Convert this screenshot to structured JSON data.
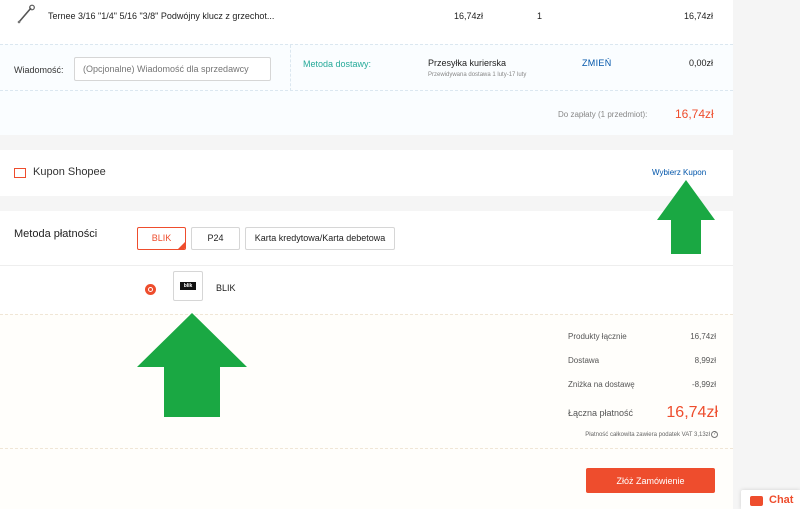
{
  "product": {
    "name": "Ternee 3/16 \"1/4\" 5/16 \"3/8\" Podwójny klucz z grzechot...",
    "price": "16,74zł",
    "quantity": "1",
    "subtotal": "16,74zł",
    "thumbnail_icon": "wrench-icon"
  },
  "message": {
    "label": "Wiadomość:",
    "placeholder": "(Opcjonalne) Wiadomość dla sprzedawcy"
  },
  "shipping": {
    "label": "Metoda dostawy:",
    "method": "Przesyłka kurierska",
    "eta": "Przewidywana dostawa 1 luty-17 luty",
    "change_label": "ZMIEŃ",
    "price": "0,00zł"
  },
  "order_total": {
    "label": "Do zapłaty (1 przedmiot):",
    "value": "16,74zł"
  },
  "coupon": {
    "title": "Kupon Shopee",
    "action": "Wybierz Kupon"
  },
  "payment": {
    "title": "Metoda płatności",
    "options": [
      "BLIK",
      "P24",
      "Karta kredytowa/Karta debetowa"
    ],
    "selected": "BLIK",
    "selected_logo_text": "blik",
    "selected_label": "BLIK"
  },
  "summary": {
    "rows": [
      {
        "label": "Produkty łącznie",
        "value": "16,74zł"
      },
      {
        "label": "Dostawa",
        "value": "8,99zł"
      },
      {
        "label": "Zniżka na dostawę",
        "value": "-8,99zł"
      }
    ],
    "grand_total_label": "Łączna płatność",
    "grand_total_value": "16,74zł",
    "vat_note": "Płatność całkowita zawiera podatek VAT 3,13zł",
    "vat_info_glyph": "?"
  },
  "order_button": "Złóż Zamówienie",
  "chat": {
    "label": "Chat"
  },
  "colors": {
    "accent": "#ee4d2d",
    "link": "#0055aa",
    "teal": "#26aa99",
    "annotation_arrow": "#1aa843"
  }
}
